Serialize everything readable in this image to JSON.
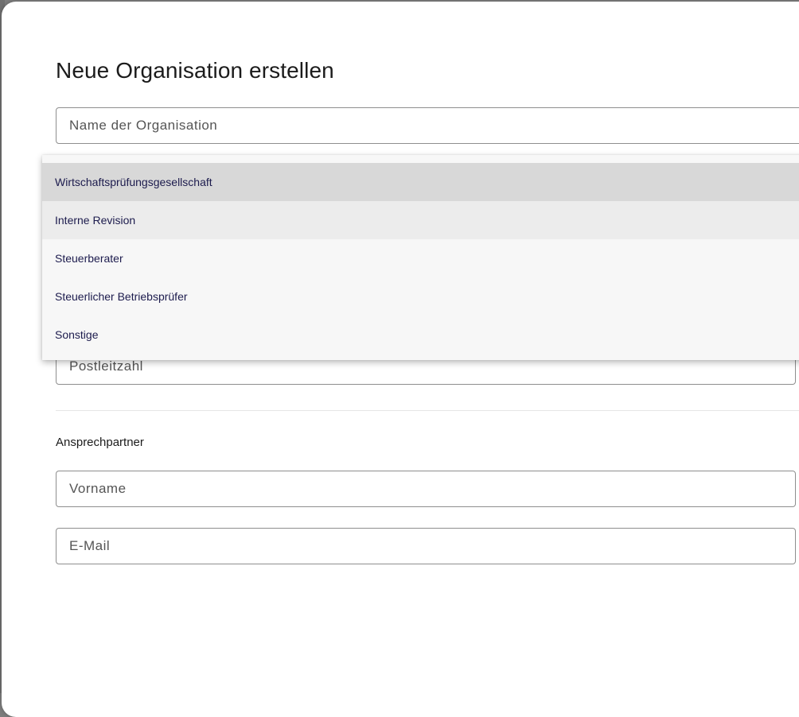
{
  "dialog": {
    "title": "Neue Organisation erstellen"
  },
  "form": {
    "name_placeholder": "Name der Organisation",
    "postleitzahl_placeholder": "Postleitzahl",
    "section_contact": "Ansprechpartner",
    "vorname_placeholder": "Vorname",
    "email_placeholder": "E-Mail"
  },
  "dropdown": {
    "options": [
      {
        "label": "Wirtschaftsprüfungsgesellschaft",
        "state": "selected"
      },
      {
        "label": "Interne Revision",
        "state": "hovered"
      },
      {
        "label": "Steuerberater",
        "state": "default"
      },
      {
        "label": "Steuerlicher Betriebsprüfer",
        "state": "default"
      },
      {
        "label": "Sonstige",
        "state": "default"
      }
    ]
  },
  "colors": {
    "option_text": "#1c1b4d",
    "selected_bg": "#d8d8d8",
    "hover_bg": "#ececec",
    "menu_bg": "#f7f7f7",
    "border": "#8e8e8e"
  }
}
